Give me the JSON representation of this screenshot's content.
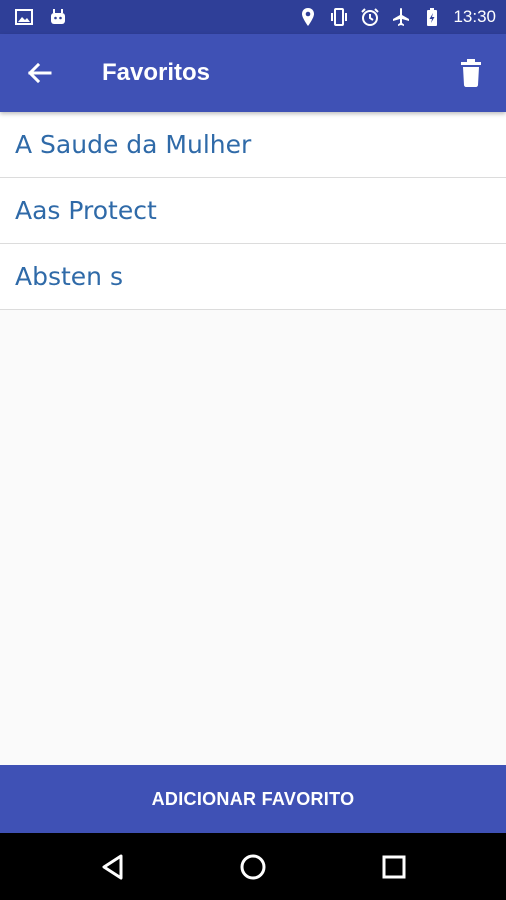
{
  "status_bar": {
    "time": "13:30",
    "left_icons": [
      "image-icon",
      "android-icon"
    ],
    "right_icons": [
      "location-icon",
      "vibrate-icon",
      "alarm-icon",
      "airplane-icon",
      "battery-charging-icon"
    ]
  },
  "app_bar": {
    "title": "Favoritos",
    "back_icon": "arrow-back-icon",
    "action_icon": "trash-icon",
    "color": "#3f51b5"
  },
  "favorites": [
    {
      "label": "A Saude da Mulher"
    },
    {
      "label": "Aas Protect"
    },
    {
      "label": "Absten s"
    }
  ],
  "add_button": {
    "label": "ADICIONAR FAVORITO"
  },
  "nav_bar": {
    "icons": [
      "back-triangle-icon",
      "home-circle-icon",
      "recents-square-icon"
    ]
  },
  "colors": {
    "primary": "#3f51b5",
    "primary_dark": "#2f3f98",
    "item_text": "#2f6aa8",
    "background": "#fafafa"
  }
}
